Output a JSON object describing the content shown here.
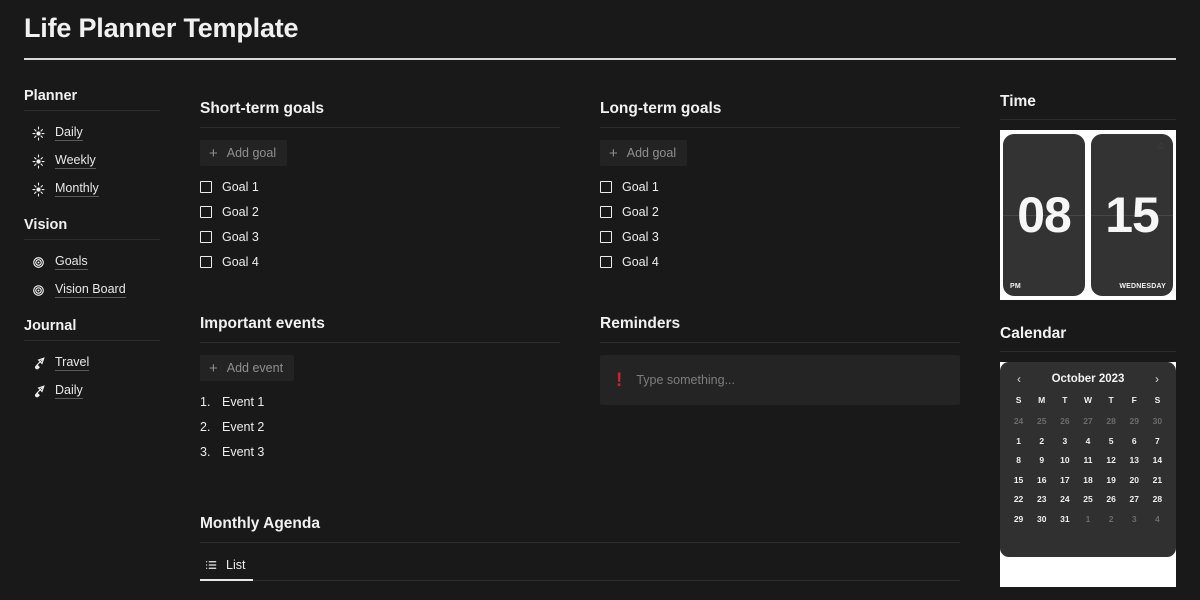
{
  "header": {
    "title": "Life Planner Template"
  },
  "sidebar": {
    "sections": [
      {
        "title": "Planner",
        "icon": "sun-icon",
        "items": [
          {
            "label": "Daily"
          },
          {
            "label": "Weekly"
          },
          {
            "label": "Monthly"
          }
        ]
      },
      {
        "title": "Vision",
        "icon": "target-icon",
        "items": [
          {
            "label": "Goals"
          },
          {
            "label": "Vision Board"
          }
        ]
      },
      {
        "title": "Journal",
        "icon": "paintbrush-icon",
        "items": [
          {
            "label": "Travel"
          },
          {
            "label": "Daily"
          }
        ]
      }
    ]
  },
  "short_term": {
    "title": "Short-term goals",
    "add_label": "Add goal",
    "goals": [
      {
        "label": "Goal 1",
        "checked": false
      },
      {
        "label": "Goal 2",
        "checked": false
      },
      {
        "label": "Goal 3",
        "checked": false
      },
      {
        "label": "Goal 4",
        "checked": false
      }
    ]
  },
  "long_term": {
    "title": "Long-term goals",
    "add_label": "Add goal",
    "goals": [
      {
        "label": "Goal 1",
        "checked": false
      },
      {
        "label": "Goal 2",
        "checked": false
      },
      {
        "label": "Goal 3",
        "checked": false
      },
      {
        "label": "Goal 4",
        "checked": false
      }
    ]
  },
  "events": {
    "title": "Important events",
    "add_label": "Add event",
    "items": [
      {
        "index": "1.",
        "label": "Event 1"
      },
      {
        "index": "2.",
        "label": "Event 2"
      },
      {
        "index": "3.",
        "label": "Event 3"
      }
    ]
  },
  "reminders": {
    "title": "Reminders",
    "icon": "exclamation-icon",
    "marker": "!",
    "placeholder": "Type something...",
    "value": "",
    "marker_color": "#c9262b"
  },
  "agenda": {
    "title": "Monthly Agenda",
    "tabs": [
      {
        "label": "List",
        "icon": "list-icon",
        "active": true
      }
    ]
  },
  "time": {
    "title": "Time",
    "hour": "08",
    "meridiem": "PM",
    "day_number": "15",
    "weekday": "WEDNESDAY"
  },
  "calendar": {
    "title": "Calendar",
    "month": "October 2023",
    "prev_icon": "chevron-left-icon",
    "next_icon": "chevron-right-icon",
    "prev_glyph": "‹",
    "next_glyph": "›",
    "dow": [
      "S",
      "M",
      "T",
      "W",
      "T",
      "F",
      "S"
    ],
    "weeks": [
      [
        {
          "d": "24",
          "muted": true
        },
        {
          "d": "25",
          "muted": true
        },
        {
          "d": "26",
          "muted": true
        },
        {
          "d": "27",
          "muted": true
        },
        {
          "d": "28",
          "muted": true
        },
        {
          "d": "29",
          "muted": true
        },
        {
          "d": "30",
          "muted": true
        }
      ],
      [
        {
          "d": "1",
          "muted": false
        },
        {
          "d": "2",
          "muted": false
        },
        {
          "d": "3",
          "muted": false
        },
        {
          "d": "4",
          "muted": false
        },
        {
          "d": "5",
          "muted": false
        },
        {
          "d": "6",
          "muted": false
        },
        {
          "d": "7",
          "muted": false
        }
      ],
      [
        {
          "d": "8",
          "muted": false
        },
        {
          "d": "9",
          "muted": false
        },
        {
          "d": "10",
          "muted": false
        },
        {
          "d": "11",
          "muted": false
        },
        {
          "d": "12",
          "muted": false
        },
        {
          "d": "13",
          "muted": false
        },
        {
          "d": "14",
          "muted": false
        }
      ],
      [
        {
          "d": "15",
          "muted": false
        },
        {
          "d": "16",
          "muted": false
        },
        {
          "d": "17",
          "muted": false
        },
        {
          "d": "18",
          "muted": false
        },
        {
          "d": "19",
          "muted": false
        },
        {
          "d": "20",
          "muted": false
        },
        {
          "d": "21",
          "muted": false
        }
      ],
      [
        {
          "d": "22",
          "muted": false
        },
        {
          "d": "23",
          "muted": false
        },
        {
          "d": "24",
          "muted": false
        },
        {
          "d": "25",
          "muted": false
        },
        {
          "d": "26",
          "muted": false
        },
        {
          "d": "27",
          "muted": false
        },
        {
          "d": "28",
          "muted": false
        }
      ],
      [
        {
          "d": "29",
          "muted": false
        },
        {
          "d": "30",
          "muted": false
        },
        {
          "d": "31",
          "muted": false
        },
        {
          "d": "1",
          "muted": true
        },
        {
          "d": "2",
          "muted": true
        },
        {
          "d": "3",
          "muted": true
        },
        {
          "d": "4",
          "muted": true
        }
      ]
    ]
  },
  "theme": {
    "background": "#191919",
    "surface": "#232323",
    "text": "#ededed",
    "muted": "#8f8f8f",
    "accent_red": "#c9262b",
    "card": "#333333",
    "panel_white": "#ffffff"
  }
}
